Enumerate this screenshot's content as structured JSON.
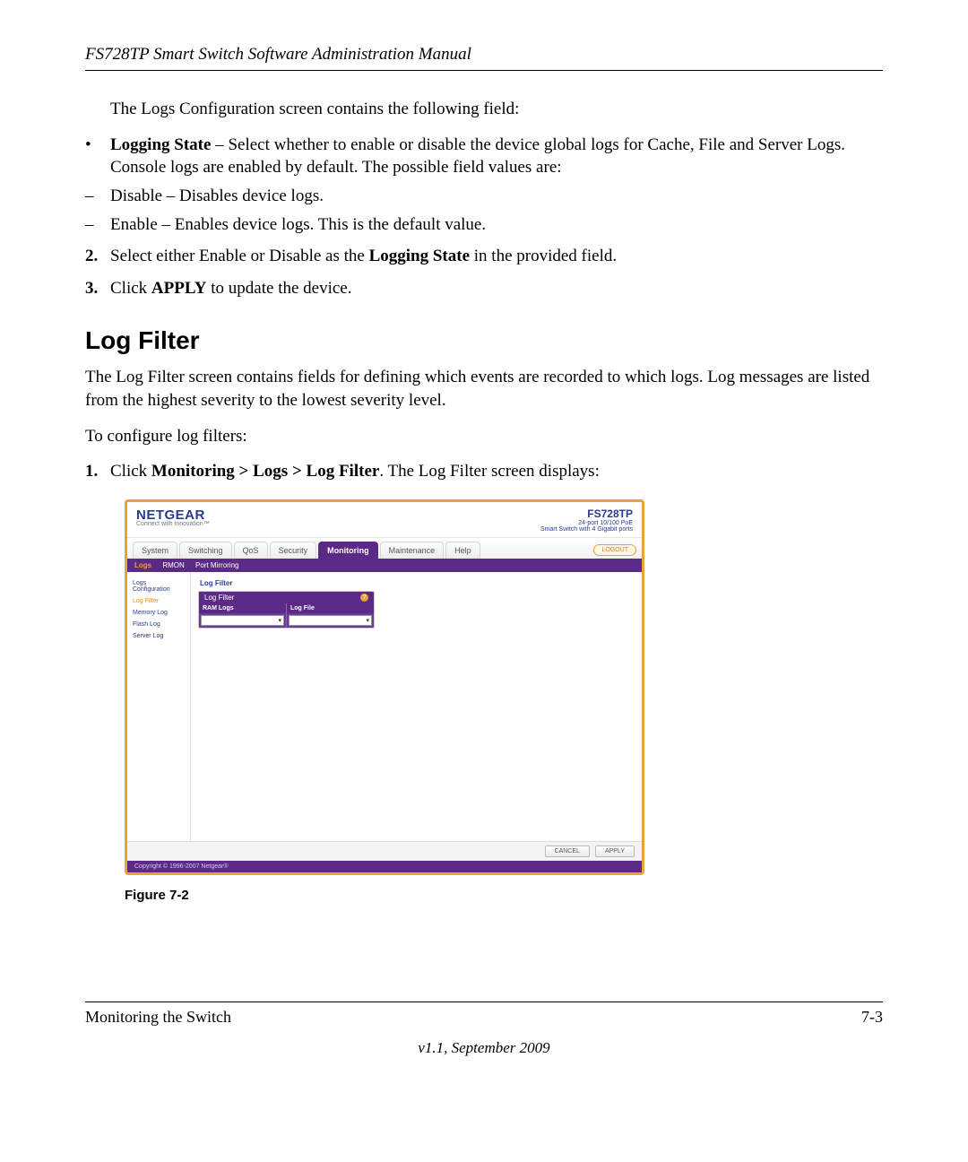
{
  "header": {
    "title": "FS728TP Smart Switch Software Administration Manual"
  },
  "intro": "The Logs Configuration screen contains the following field:",
  "logging_state_label": "Logging State",
  "logging_state_desc": " – Select whether to enable or disable the device global logs for Cache, File and Server Logs. Console logs are enabled by default. The possible field values are:",
  "opt_disable": "Disable – Disables device logs.",
  "opt_enable": "Enable – Enables device logs. This is the default value.",
  "step2_pre": "Select either Enable or Disable as the ",
  "step2_bold": "Logging State",
  "step2_post": " in the provided field.",
  "step3_pre": "Click ",
  "step3_bold": "APPLY",
  "step3_post": " to update the device.",
  "section_heading": "Log Filter",
  "section_p1": "The Log Filter screen contains fields for defining which events are recorded to which logs. Log messages are listed from the highest severity to the lowest severity level.",
  "section_p2": "To configure log filters:",
  "step1_pre": "Click ",
  "step1_bold": "Monitoring > Logs > Log Filter",
  "step1_post": ". The Log Filter screen displays:",
  "app": {
    "brand": "NETGEAR",
    "tagline": "Connect with Innovation™",
    "model": "FS728TP",
    "model_desc1": "24-port 10/100 PoE",
    "model_desc2": "Smart Switch with 4 Gigabit ports",
    "tabs": [
      "System",
      "Switching",
      "QoS",
      "Security",
      "Monitoring",
      "Maintenance",
      "Help"
    ],
    "active_tab": "Monitoring",
    "logout": "LOGOUT",
    "subtabs": {
      "items": [
        "Logs",
        "RMON",
        "Port Mirroring"
      ],
      "selected": "Logs"
    },
    "sidebar": [
      "Logs Configuration",
      "Log Filter",
      "Memory Log",
      "Flash Log",
      "Server Log"
    ],
    "sidebar_selected": "Log Filter",
    "panel_title": "Log Filter",
    "panel_head": "Log Filter",
    "col1": "RAM Logs",
    "col2": "Log File",
    "buttons": {
      "cancel": "CANCEL",
      "apply": "APPLY"
    },
    "copyright": "Copyright © 1996-2007 Netgear®"
  },
  "figure_caption": "Figure 7-2",
  "footer": {
    "left": "Monitoring the Switch",
    "right": "7-3",
    "version": "v1.1, September 2009"
  },
  "marks": {
    "bullet": "•",
    "dash": "–",
    "n2": "2.",
    "n3": "3.",
    "n1": "1."
  }
}
